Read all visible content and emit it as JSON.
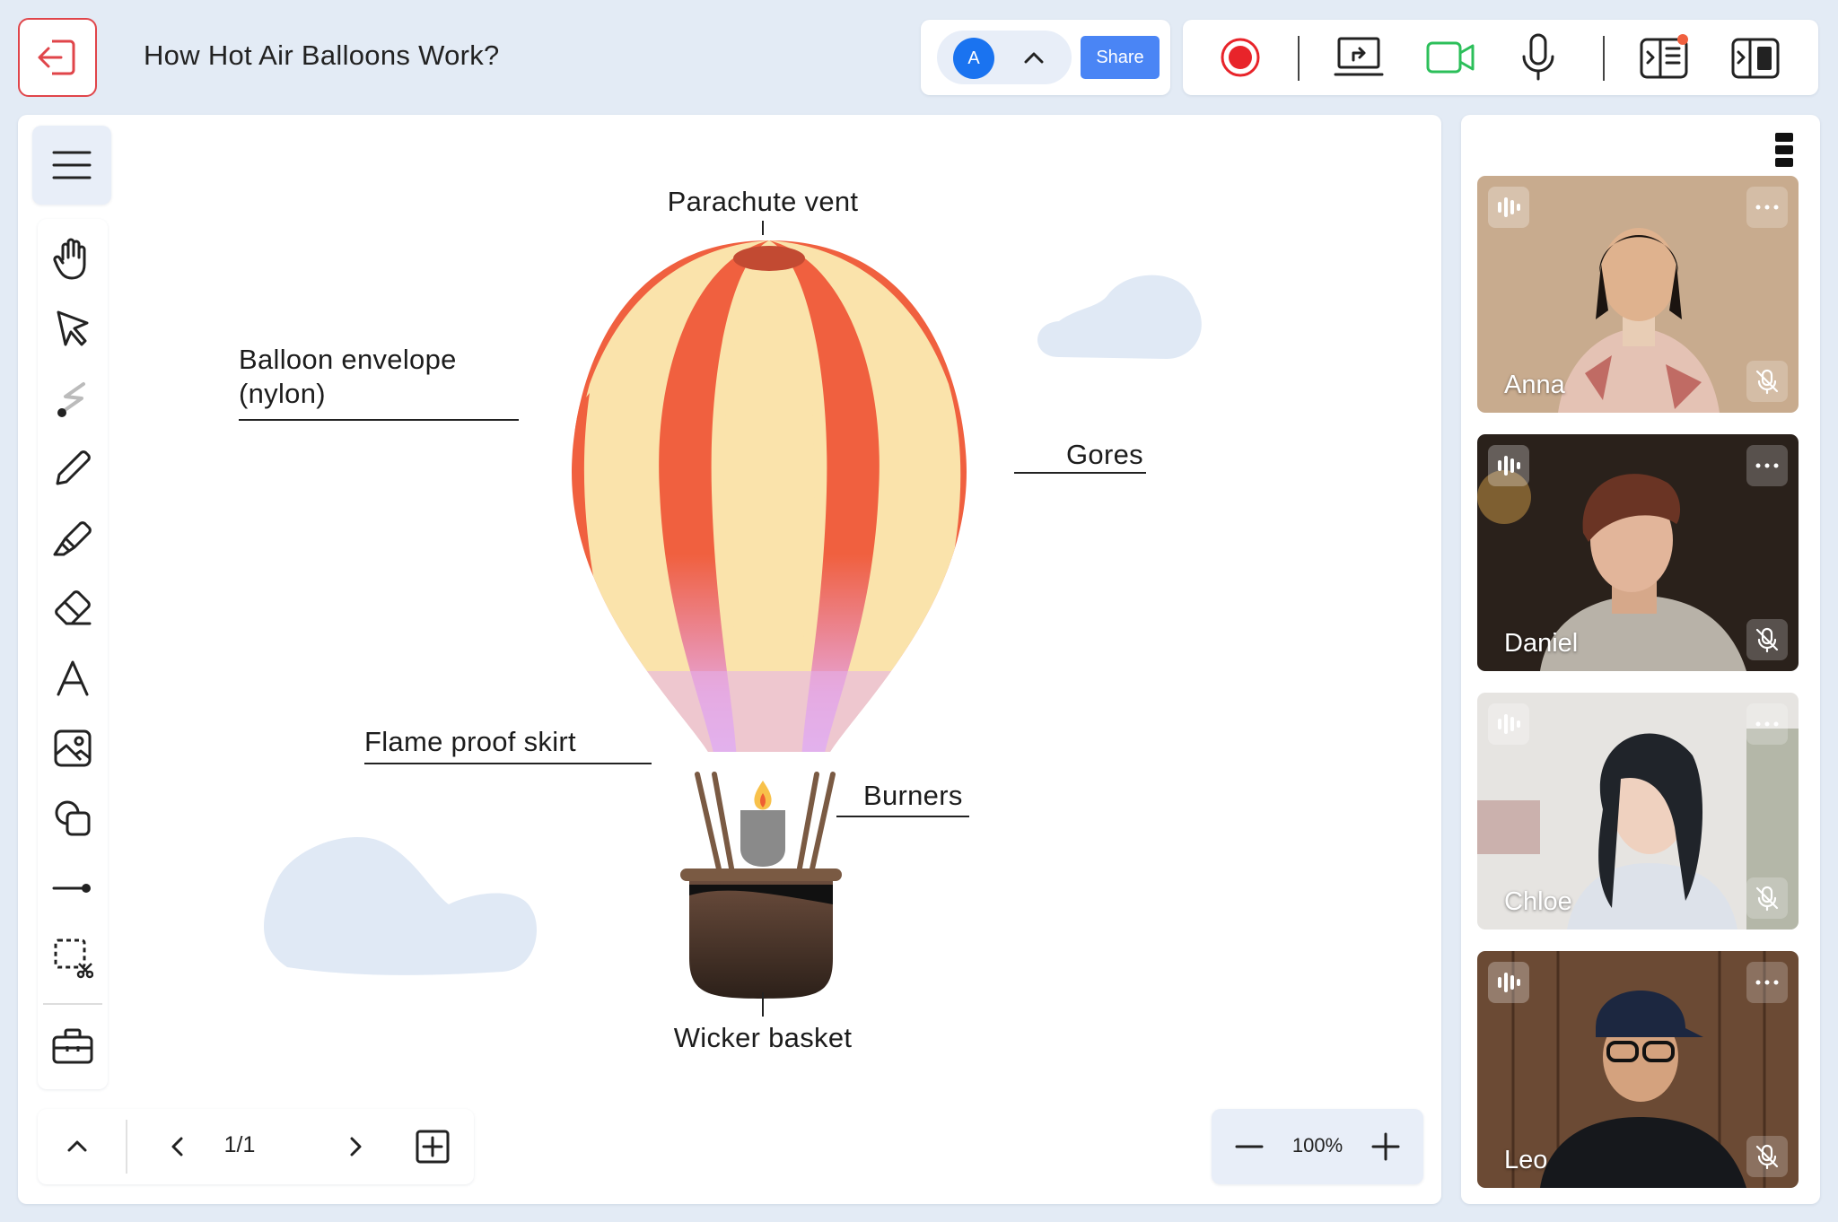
{
  "header": {
    "title": "How Hot Air Balloons Work?",
    "avatar_initial": "A",
    "share_label": "Share"
  },
  "icons": {
    "exit": "exit-icon",
    "record": "record-icon",
    "screen_share": "screen-share-icon",
    "camera": "video-camera-icon",
    "microphone": "microphone-icon",
    "layout_left": "layout-left-icon",
    "layout_right": "layout-right-icon"
  },
  "toolbar": {
    "tools": [
      "hand-icon",
      "select-icon",
      "laser-pointer-icon",
      "pen-icon",
      "highlighter-icon",
      "eraser-icon",
      "text-icon",
      "image-icon",
      "shapes-icon",
      "line-icon",
      "lasso-cut-icon",
      "toolbox-icon"
    ]
  },
  "diagram": {
    "labels": {
      "parachute_vent": "Parachute vent",
      "envelope_line1": "Balloon envelope",
      "envelope_line2": "(nylon)",
      "gores": "Gores",
      "skirt": "Flame proof skirt",
      "burners": "Burners",
      "basket": "Wicker basket"
    },
    "colors": {
      "stripe_red": "#f0603f",
      "stripe_cream": "#fae3ab",
      "skirt_pink": "#e0b6f4",
      "rope": "#7a5a43",
      "basket_dark": "#3a2a22",
      "cloud": "#e0e9f5"
    }
  },
  "pagination": {
    "current": "1/1"
  },
  "zoom": {
    "level": "100%"
  },
  "participants": [
    {
      "name": "Anna"
    },
    {
      "name": "Daniel"
    },
    {
      "name": "Chloe"
    },
    {
      "name": "Leo"
    }
  ],
  "colors": {
    "accent": "#4a85f5",
    "avatar": "#1a73f0",
    "exit_red": "#e0454a",
    "record_red": "#e8242a",
    "camera_green": "#2cbf5a"
  }
}
